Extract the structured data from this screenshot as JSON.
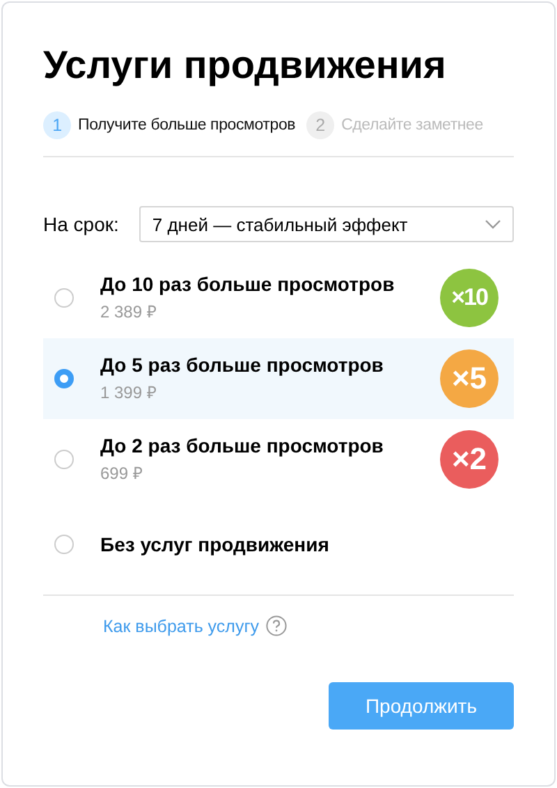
{
  "title": "Услуги продвижения",
  "steps": [
    {
      "number": "1",
      "label": "Получите больше просмотров",
      "selected": true
    },
    {
      "number": "2",
      "label": "Сделайте заметнее",
      "selected": false
    }
  ],
  "period": {
    "label": "На срок:",
    "value": "7 дней — стабильный эффект"
  },
  "options": [
    {
      "title": "До 10 раз больше просмотров",
      "price": "2 389 ₽",
      "badge": "×10",
      "color": "#8dc440",
      "selected": false
    },
    {
      "title": "До 5 раз больше просмотров",
      "price": "1 399 ₽",
      "badge": "×5",
      "color": "#f4a844",
      "selected": true
    },
    {
      "title": "До 2 раз больше просмотров",
      "price": "699 ₽",
      "badge": "×2",
      "color": "#ea5d5d",
      "selected": false
    },
    {
      "title": "Без услуг продвижения",
      "selected": false
    }
  ],
  "help_link": "Как выбрать услугу",
  "continue_button": "Продолжить"
}
